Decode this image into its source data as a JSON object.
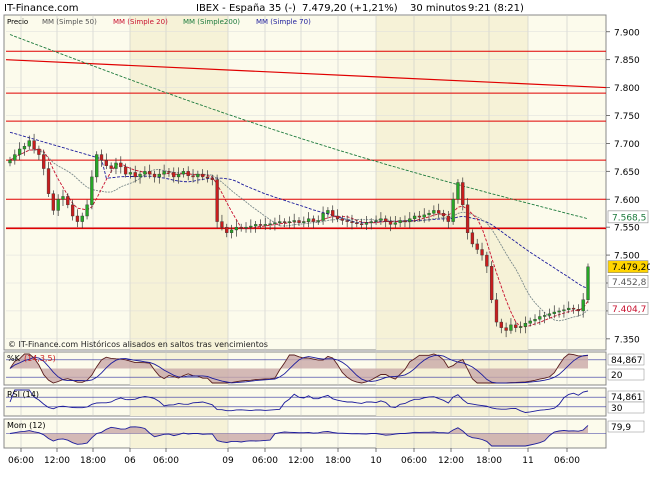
{
  "header": {
    "site": "IT-Finance.com",
    "instrument": "IBEX - España 35 (-)",
    "last_quote": "7.479,20 (+1,21%)",
    "interval": "30 minutos",
    "time": "9:21 (8:21)"
  },
  "legend": {
    "price": "Precio",
    "ma50": "MM (Simple 50)",
    "ma20": "MM (Simple 20)",
    "ma200": "MM (Simple200)",
    "ma70": "MM (Simple 70)"
  },
  "footer_note": "© IT-Finance.com  Históricos alisados en saltos tras vencimientos",
  "colors": {
    "background": "#ffffff",
    "panel_bg": "#fcfbec",
    "shade": "#f6f2d7",
    "up": "#26a626",
    "down": "#c81e1e",
    "ma20": "#c8102e",
    "ma50": "#7b8a8b",
    "ma70": "#1c1c9c",
    "ma200": "#1c7a3c",
    "resistance": "#e00000"
  },
  "chart_data": [
    {
      "type": "candlestick",
      "name": "price",
      "yaxis_ticks": [
        "7.900",
        "7.850",
        "7.800",
        "7.750",
        "7.700",
        "7.650",
        "7.600",
        "7.550",
        "7.500",
        "7.450",
        "7.400",
        "7.350"
      ],
      "ylim": [
        7330,
        7930
      ],
      "xaxis_ticks": [
        "06:00",
        "12:00",
        "18:00",
        "06",
        "06:00",
        "09",
        "06:00",
        "12:00",
        "18:00",
        "10",
        "06:00",
        "12:00",
        "18:00",
        "11",
        "06:00"
      ],
      "price_labels": {
        "ma200": "7.568,5",
        "last": "7.479,20",
        "ma50": "7.452,8",
        "ma20": "7.404,7"
      },
      "horizontal_lines": [
        7865,
        7790,
        7740,
        7670,
        7600,
        7548
      ],
      "trend_line": {
        "from": 7850,
        "to": 7800
      },
      "close": [
        7670,
        7680,
        7690,
        7695,
        7705,
        7690,
        7680,
        7655,
        7610,
        7580,
        7600,
        7605,
        7590,
        7570,
        7560,
        7570,
        7590,
        7640,
        7680,
        7670,
        7660,
        7655,
        7665,
        7658,
        7645,
        7648,
        7640,
        7645,
        7650,
        7645,
        7640,
        7645,
        7650,
        7648,
        7640,
        7645,
        7650,
        7642,
        7640,
        7645,
        7640,
        7638,
        7635,
        7560,
        7550,
        7540,
        7545,
        7550,
        7548,
        7550,
        7552,
        7555,
        7553,
        7555,
        7556,
        7558,
        7560,
        7558,
        7560,
        7562,
        7558,
        7560,
        7565,
        7560,
        7562,
        7575,
        7580,
        7570,
        7565,
        7562,
        7560,
        7558,
        7556,
        7555,
        7558,
        7560,
        7562,
        7565,
        7560,
        7555,
        7558,
        7562,
        7560,
        7565,
        7570,
        7568,
        7572,
        7575,
        7580,
        7575,
        7570,
        7560,
        7600,
        7630,
        7590,
        7540,
        7520,
        7510,
        7500,
        7480,
        7420,
        7380,
        7370,
        7365,
        7375,
        7370,
        7372,
        7378,
        7382,
        7385,
        7390,
        7392,
        7395,
        7398,
        7400,
        7402,
        7405,
        7403,
        7400,
        7420,
        7479
      ],
      "series_ma": {
        "ma20": "7.404,7",
        "ma50": "7.452,8",
        "ma200": "7.568,5"
      }
    },
    {
      "type": "line",
      "name": "stochastic",
      "label": "%K",
      "label_suffix": "(14,3,5)",
      "value_label": "84,867",
      "ylim": [
        0,
        100
      ],
      "ref_lines": [
        20,
        80
      ],
      "lower_label": "20"
    },
    {
      "type": "line",
      "name": "rsi",
      "label": "RSI (14)",
      "value_label": "74,861",
      "ylim": [
        0,
        100
      ],
      "ref_lines": [
        30,
        70
      ],
      "lower_label": "30"
    },
    {
      "type": "area",
      "name": "momentum",
      "label": "Mom (12)",
      "value_label": "79,9",
      "ylim": [
        -160,
        120
      ]
    }
  ]
}
